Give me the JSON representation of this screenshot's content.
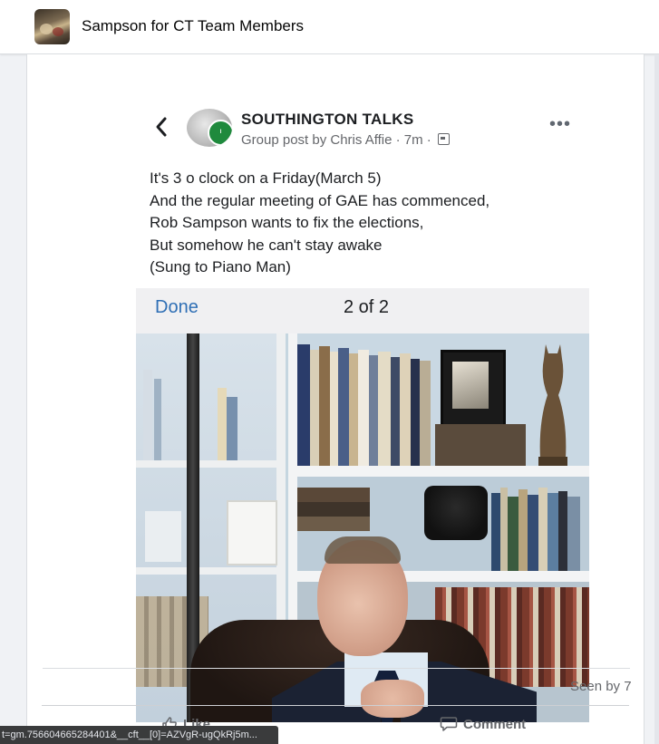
{
  "header": {
    "group_title": "Sampson for CT Team Members"
  },
  "post": {
    "embedded": {
      "group_name": "SOUTHINGTON TALKS",
      "meta": "Group post by Chris Affie · 7m ·",
      "badge_text": "I VOTED",
      "lines": [
        "It's 3 o clock on a Friday(March 5)",
        "And the regular meeting of GAE has commenced,",
        "Rob Sampson wants to fix the elections,",
        "But somehow he can't stay awake",
        "(Sung to Piano Man)"
      ],
      "viewer": {
        "done_label": "Done",
        "page_count": "2 of 2"
      }
    },
    "seen_by": "Seen by 7",
    "actions": {
      "like_label": "Like",
      "comment_label": "Comment"
    }
  },
  "status_url": "t=gm.756604665284401&__cft__[0]=AZVgR-ugQkRj5m...",
  "colors": {
    "accent_blue": "#2f6fb5",
    "muted_text": "#65676b",
    "badge_green": "#1f8a3d"
  }
}
